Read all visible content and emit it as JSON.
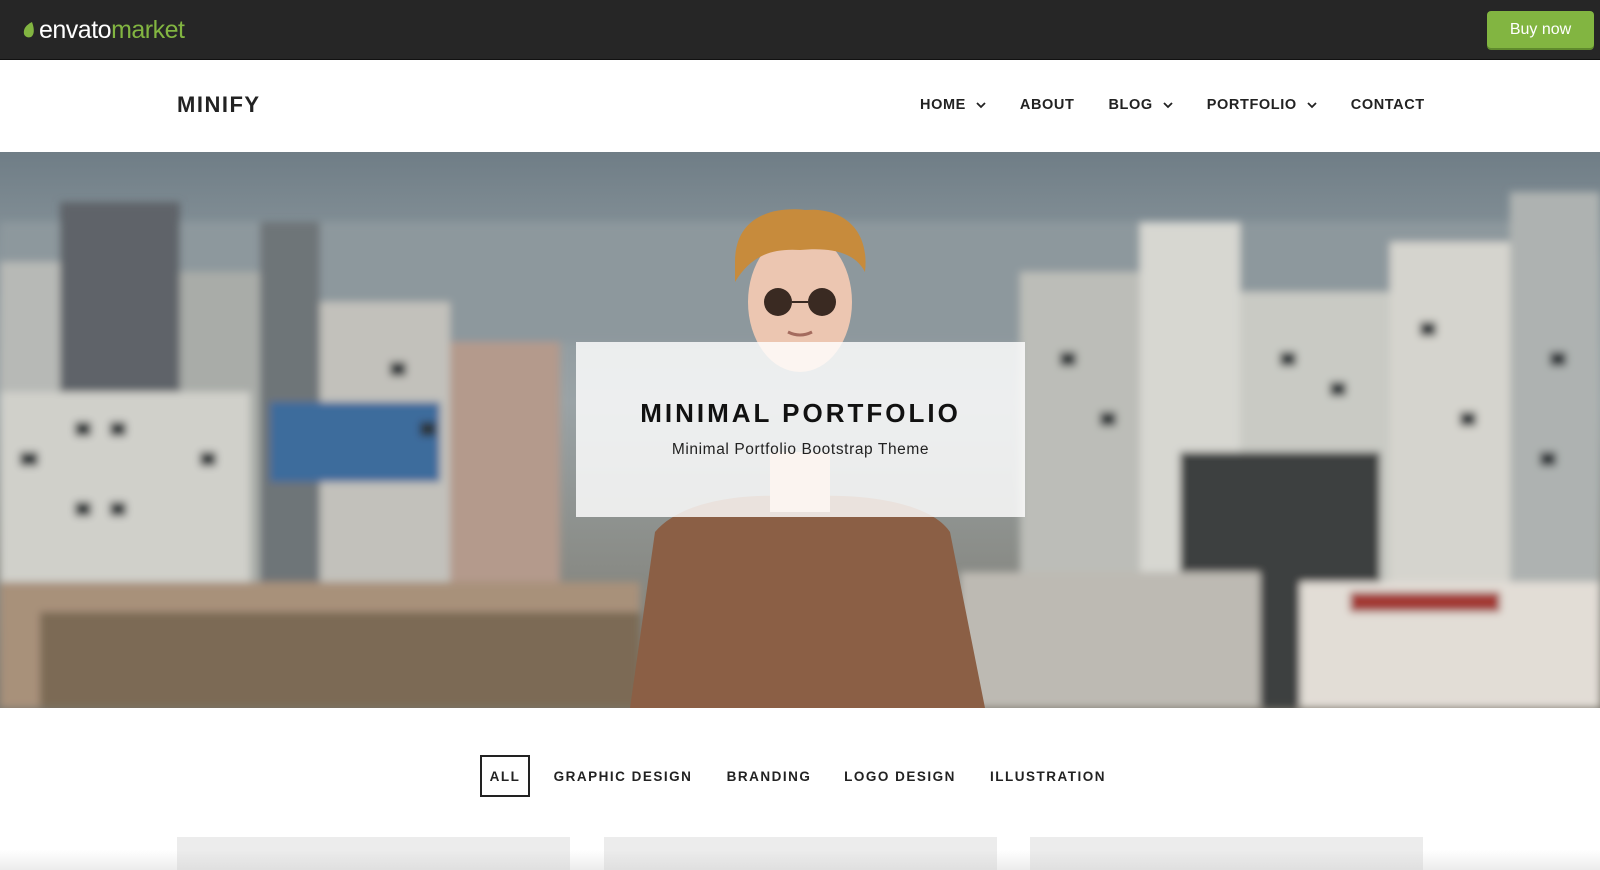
{
  "envato_bar": {
    "logo_part1": "envato",
    "logo_part2": "market",
    "buy_label": "Buy now",
    "colors": {
      "bar": "#262626",
      "accent": "#82b541"
    }
  },
  "header": {
    "brand": "MINIFY",
    "nav": [
      {
        "label": "HOME",
        "has_dropdown": true
      },
      {
        "label": "ABOUT",
        "has_dropdown": false
      },
      {
        "label": "BLOG",
        "has_dropdown": true
      },
      {
        "label": "PORTFOLIO",
        "has_dropdown": true
      },
      {
        "label": "CONTACT",
        "has_dropdown": false
      }
    ]
  },
  "hero": {
    "title": "MINIMAL PORTFOLIO",
    "subtitle": "Minimal Portfolio Bootstrap Theme",
    "image": "young man in sunglasses and brown t-shirt in front of blurred city buildings"
  },
  "filters": [
    {
      "label": "ALL",
      "active": true
    },
    {
      "label": "GRAPHIC DESIGN",
      "active": false
    },
    {
      "label": "BRANDING",
      "active": false
    },
    {
      "label": "LOGO DESIGN",
      "active": false
    },
    {
      "label": "ILLUSTRATION",
      "active": false
    }
  ]
}
